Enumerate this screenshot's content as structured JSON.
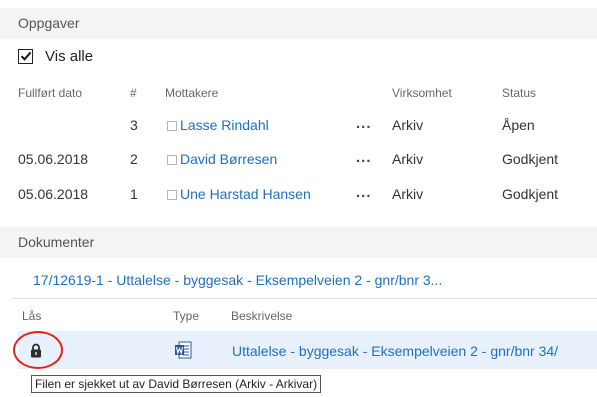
{
  "tasks": {
    "header": "Oppgaver",
    "show_all": {
      "label": "Vis alle",
      "checked": true
    },
    "columns": {
      "completed_date": "Fullført dato",
      "number": "#",
      "recipients": "Mottakere",
      "unit": "Virksomhet",
      "status": "Status"
    },
    "rows": [
      {
        "completed_date": "",
        "number": "3",
        "recipient": "Lasse Rindahl",
        "actions": "...",
        "unit": "Arkiv",
        "status": "Åpen"
      },
      {
        "completed_date": "05.06.2018",
        "number": "2",
        "recipient": "David Børresen",
        "actions": "...",
        "unit": "Arkiv",
        "status": "Godkjent"
      },
      {
        "completed_date": "05.06.2018",
        "number": "1",
        "recipient": "Une Harstad Hansen",
        "actions": "...",
        "unit": "Arkiv",
        "status": "Godkjent"
      }
    ]
  },
  "documents": {
    "header": "Dokumenter",
    "record_link": "17/12619-1 - Uttalelse - byggesak - Eksempelveien 2 - gnr/bnr 3...",
    "columns": {
      "lock": "Lås",
      "type": "Type",
      "description": "Beskrivelse"
    },
    "rows": [
      {
        "lock_icon": "lock-icon",
        "type_icon": "word-document-icon",
        "description": "Uttalelse - byggesak - Eksempelveien 2 - gnr/bnr 34/"
      }
    ],
    "tooltip": "Filen er sjekket ut av David Børresen (Arkiv - Arkivar)"
  },
  "colors": {
    "link": "#1f6fbf",
    "header_bg": "#f4f4f4",
    "selected_row_bg": "#e8f1fb",
    "highlight_circle": "#e3241b"
  }
}
